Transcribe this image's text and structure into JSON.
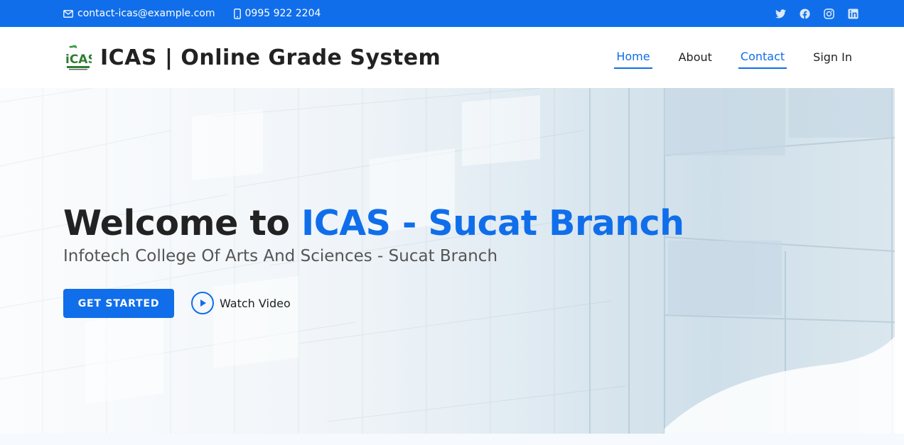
{
  "topbar": {
    "email": "contact-icas@example.com",
    "phone": "0995 922 2204",
    "social": [
      {
        "icon": "twitter-icon"
      },
      {
        "icon": "facebook-icon"
      },
      {
        "icon": "instagram-icon"
      },
      {
        "icon": "linkedin-icon"
      }
    ]
  },
  "header": {
    "title": "ICAS | Online Grade System",
    "logo_text": "iCAS",
    "nav": [
      {
        "label": "Home",
        "active": true
      },
      {
        "label": "About",
        "active": false
      },
      {
        "label": "Contact",
        "active": true
      },
      {
        "label": "Sign In",
        "active": false
      }
    ]
  },
  "hero": {
    "title_prefix": "Welcome to ",
    "title_highlight": "ICAS - Sucat Branch",
    "subtitle": "Infotech College Of Arts And Sciences - Sucat Branch",
    "cta_label": "GET STARTED",
    "watch_label": "Watch Video"
  },
  "colors": {
    "accent": "#106eea",
    "text": "#222222"
  }
}
